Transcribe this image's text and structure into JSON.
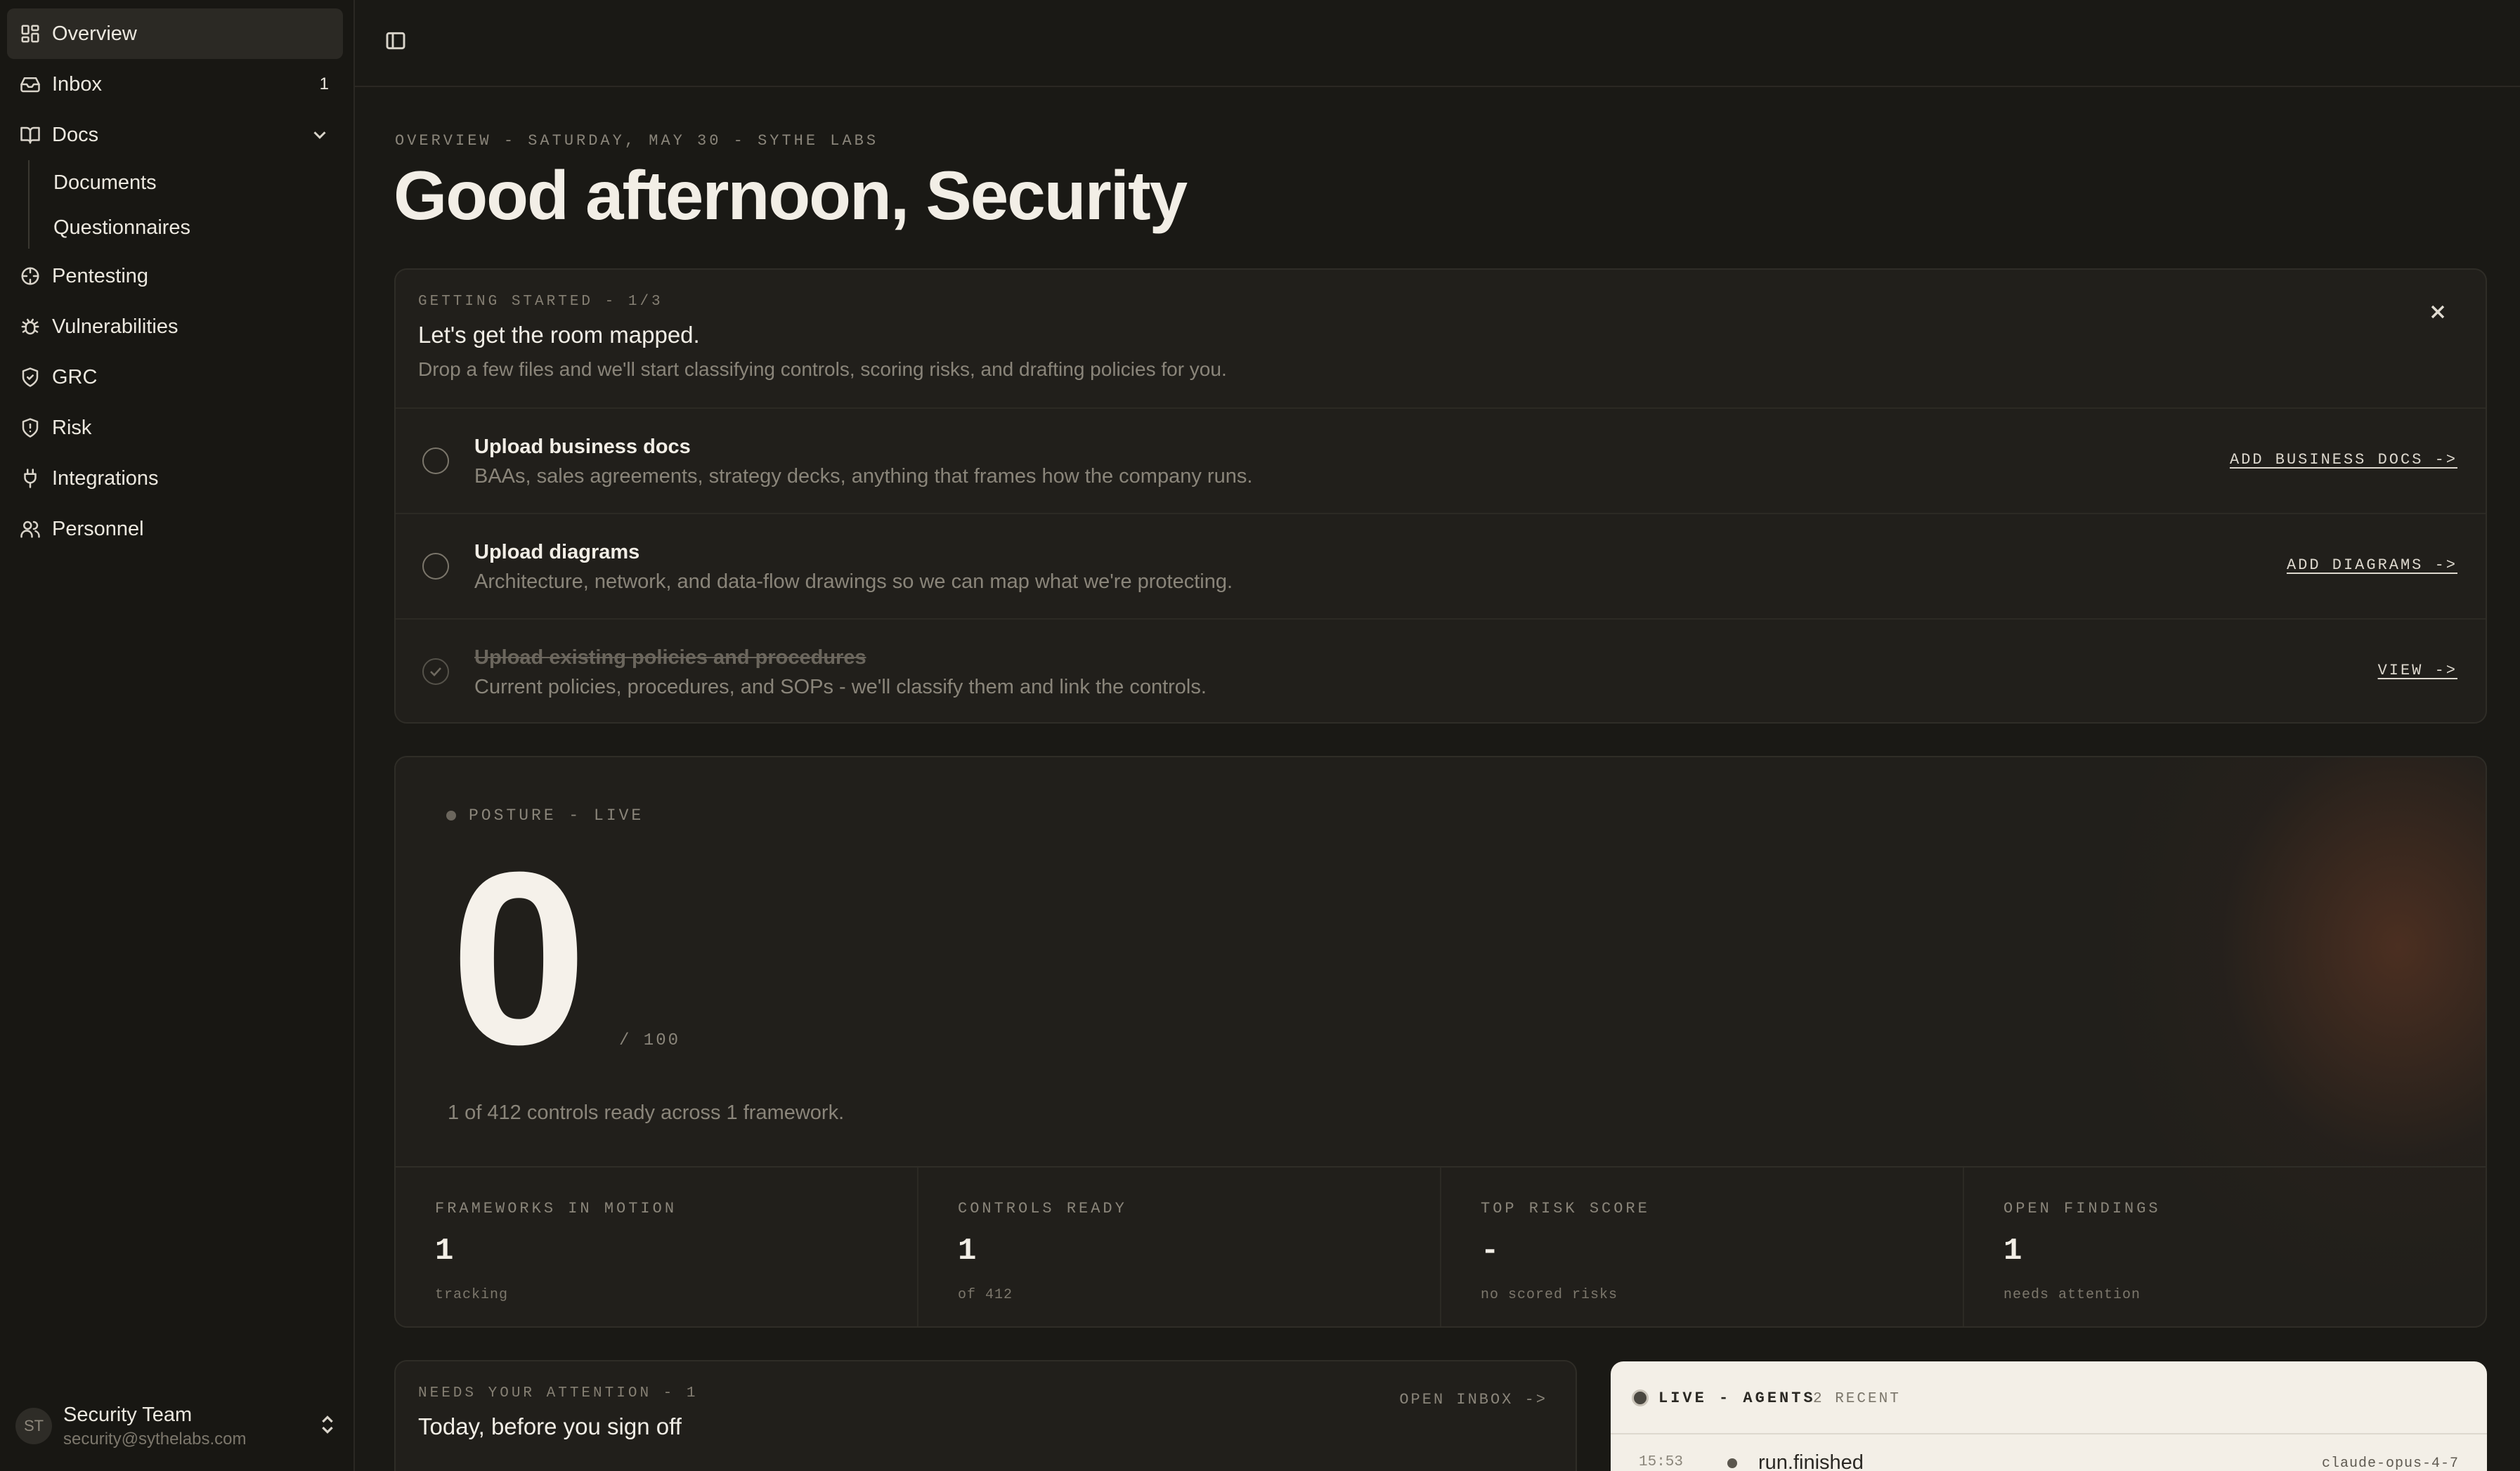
{
  "sidebar": {
    "items": [
      {
        "label": "Overview",
        "icon": "dashboard-icon"
      },
      {
        "label": "Inbox",
        "icon": "inbox-icon",
        "badge": "1"
      },
      {
        "label": "Docs",
        "icon": "book-icon"
      },
      {
        "label": "Pentesting",
        "icon": "crosshair-icon"
      },
      {
        "label": "Vulnerabilities",
        "icon": "bug-icon"
      },
      {
        "label": "GRC",
        "icon": "shield-check-icon"
      },
      {
        "label": "Risk",
        "icon": "shield-alert-icon"
      },
      {
        "label": "Integrations",
        "icon": "plug-icon"
      },
      {
        "label": "Personnel",
        "icon": "users-icon"
      }
    ],
    "docs_children": [
      "Documents",
      "Questionnaires"
    ],
    "user": {
      "initials": "ST",
      "name": "Security Team",
      "email": "security@sythelabs.com"
    }
  },
  "header": {
    "eyebrow": "OVERVIEW - SATURDAY, MAY 30 - SYTHE LABS",
    "greeting": "Good afternoon, Security"
  },
  "getting_started": {
    "eyebrow": "GETTING STARTED - 1/3",
    "title": "Let's get the room mapped.",
    "description": "Drop a few files and we'll start classifying controls, scoring risks, and drafting policies for you.",
    "steps": [
      {
        "title": "Upload business docs",
        "description": "BAAs, sales agreements, strategy decks, anything that frames how the company runs.",
        "action": "ADD BUSINESS DOCS ->",
        "done": false
      },
      {
        "title": "Upload diagrams",
        "description": "Architecture, network, and data-flow drawings so we can map what we're protecting.",
        "action": "ADD DIAGRAMS ->",
        "done": false
      },
      {
        "title": "Upload existing policies and procedures",
        "description": "Current policies, procedures, and SOPs - we'll classify them and link the controls.",
        "action": "VIEW ->",
        "done": true
      }
    ]
  },
  "posture": {
    "tag": "POSTURE - LIVE",
    "score": "0",
    "max": "/ 100",
    "summary": "1 of 412 controls ready across 1 framework.",
    "stats": [
      {
        "label": "FRAMEWORKS IN MOTION",
        "value": "1",
        "sub": "tracking"
      },
      {
        "label": "CONTROLS READY",
        "value": "1",
        "sub": "of 412"
      },
      {
        "label": "TOP RISK SCORE",
        "value": "-",
        "sub": "no scored risks"
      },
      {
        "label": "OPEN FINDINGS",
        "value": "1",
        "sub": "needs attention"
      }
    ]
  },
  "attention": {
    "eyebrow": "NEEDS YOUR ATTENTION - 1",
    "title": "Today, before you sign off",
    "link": "OPEN INBOX ->"
  },
  "live_agents": {
    "label": "LIVE - AGENTS",
    "count": "2 RECENT",
    "events": [
      {
        "time": "15:53",
        "event": "run.finished",
        "model": "claude-opus-4-7"
      }
    ]
  },
  "colors": {
    "background": "#1a1915",
    "card": "#211f1b",
    "accent_glow": "#6e3c26",
    "live_card": "#f3efe7"
  }
}
